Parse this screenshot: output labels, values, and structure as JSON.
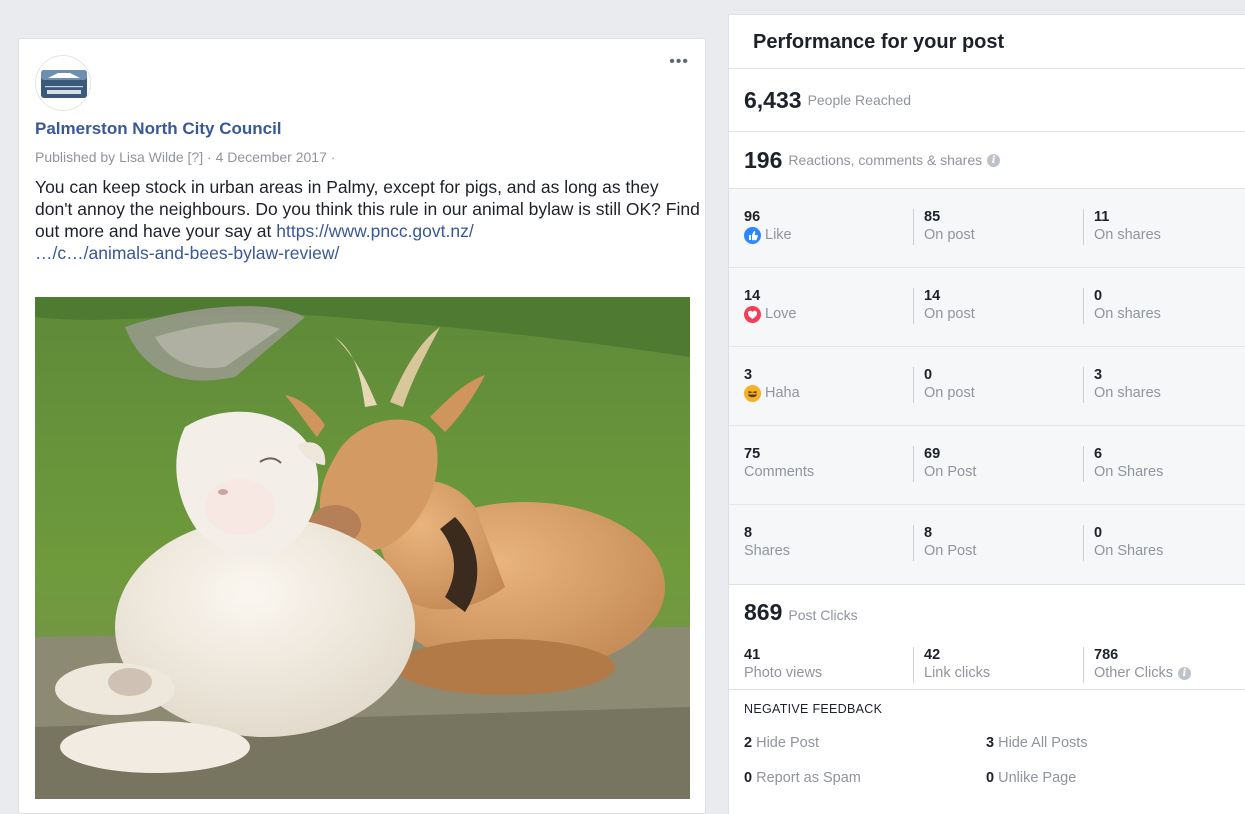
{
  "post": {
    "more_label": "•••",
    "page_name": "Palmerston North City Council",
    "logo_text": "PALMERSTON NORTH CITY COUNCIL",
    "published_prefix": "Published by",
    "publisher": "Lisa Wilde",
    "help_marker": "[?]",
    "date": "4 December 2017",
    "text": "You can keep stock in urban areas in Palmy, except for pigs, and as long as they don't annoy the neighbours. Do you think this rule in our animal bylaw is still OK? Find out more and have your say at",
    "link_line1": "https://www.pncc.govt.nz/",
    "link_line2": "…/c…/animals-and-bees-bylaw-review/"
  },
  "insights": {
    "title": "Performance for your post",
    "reached": {
      "value": "6,433",
      "label": "People Reached"
    },
    "reactions": {
      "value": "196",
      "label": "Reactions, comments & shares"
    },
    "rows": [
      {
        "name": "like",
        "cells": [
          {
            "value": "96",
            "label": "Like"
          },
          {
            "value": "85",
            "label": "On post"
          },
          {
            "value": "11",
            "label": "On shares"
          }
        ]
      },
      {
        "name": "love",
        "cells": [
          {
            "value": "14",
            "label": "Love"
          },
          {
            "value": "14",
            "label": "On post"
          },
          {
            "value": "0",
            "label": "On shares"
          }
        ]
      },
      {
        "name": "haha",
        "cells": [
          {
            "value": "3",
            "label": "Haha"
          },
          {
            "value": "0",
            "label": "On post"
          },
          {
            "value": "3",
            "label": "On shares"
          }
        ]
      },
      {
        "name": "comments",
        "cells": [
          {
            "value": "75",
            "label": "Comments"
          },
          {
            "value": "69",
            "label": "On Post"
          },
          {
            "value": "6",
            "label": "On Shares"
          }
        ]
      },
      {
        "name": "shares",
        "cells": [
          {
            "value": "8",
            "label": "Shares"
          },
          {
            "value": "8",
            "label": "On Post"
          },
          {
            "value": "0",
            "label": "On Shares"
          }
        ]
      }
    ],
    "clicks": {
      "value": "869",
      "label": "Post Clicks",
      "cells": [
        {
          "value": "41",
          "label": "Photo views"
        },
        {
          "value": "42",
          "label": "Link clicks"
        },
        {
          "value": "786",
          "label": "Other Clicks"
        }
      ]
    },
    "negative": {
      "title": "NEGATIVE FEEDBACK",
      "items": [
        {
          "value": "2",
          "label": "Hide Post"
        },
        {
          "value": "3",
          "label": "Hide All Posts"
        },
        {
          "value": "0",
          "label": "Report as Spam"
        },
        {
          "value": "0",
          "label": "Unlike Page"
        }
      ]
    },
    "colors": {
      "like": "#2d88ff",
      "love": "#f33e58",
      "haha": "#f7b125",
      "link": "#385898",
      "muted": "#90949c"
    },
    "icons": {
      "like": "thumbs-up-icon",
      "love": "heart-icon",
      "haha": "laughing-face-icon",
      "info": "info-icon"
    }
  }
}
